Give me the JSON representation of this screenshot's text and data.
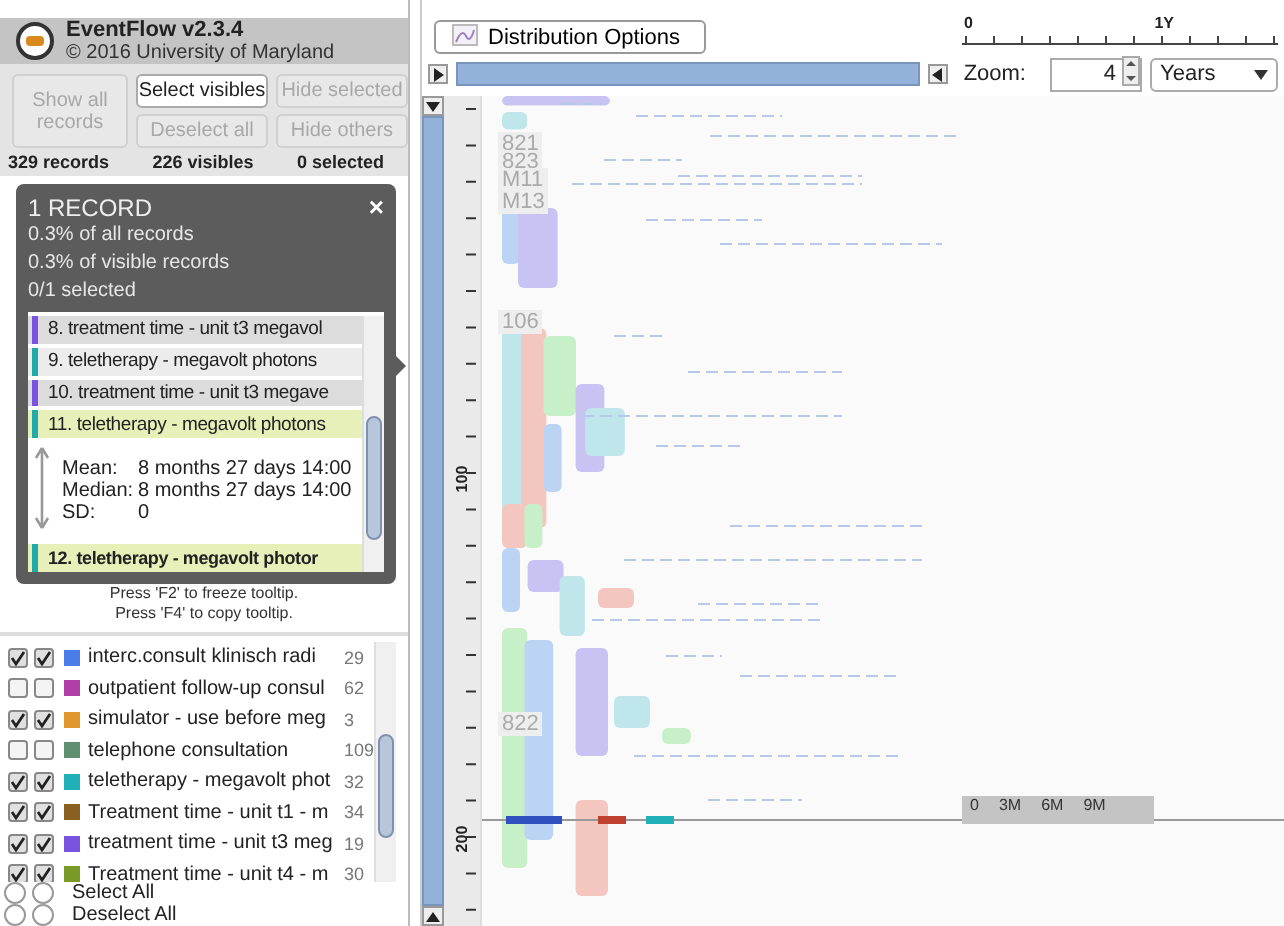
{
  "app": {
    "title": "EventFlow v2.3.4",
    "copyright": "© 2016 University of Maryland"
  },
  "record_buttons": [
    {
      "label": "Show all records",
      "disabled": true
    },
    {
      "label": "Select visibles",
      "disabled": false
    },
    {
      "label": "Hide selected",
      "disabled": true
    },
    {
      "label": "Deselect all",
      "disabled": true
    },
    {
      "label": "Hide others",
      "disabled": true
    }
  ],
  "counts": [
    "329 records",
    "226 visibles",
    "0 selected"
  ],
  "tooltip": {
    "title": "1 RECORD",
    "close": "×",
    "lines": [
      "0.3% of all records",
      "0.3% of visible records",
      "0/1 selected"
    ],
    "items": [
      {
        "kind": "event",
        "label": "8. treatment time - unit t3 megavol",
        "color": "#7b52e0",
        "highlighted": false,
        "bold": false
      },
      {
        "kind": "event",
        "label": "9. teletherapy - megavolt photons",
        "color": "#22aaaa",
        "highlighted": false,
        "bold": false
      },
      {
        "kind": "event",
        "label": "10. treatment time - unit t3 megave",
        "color": "#7b52e0",
        "highlighted": false,
        "bold": false
      },
      {
        "kind": "event",
        "label": "11. teletherapy - megavolt photons",
        "color": "#22aaaa",
        "highlighted": true,
        "bold": false
      },
      {
        "kind": "interval",
        "stats": [
          {
            "label": "Mean:",
            "value": "8 months 27 days 14:00"
          },
          {
            "label": "Median:",
            "value": "8 months 27 days 14:00"
          },
          {
            "label": "SD:",
            "value": "0"
          }
        ]
      },
      {
        "kind": "event",
        "label": "12. teletherapy - megavolt photor",
        "color": "#22aaaa",
        "highlighted": true,
        "bold": true
      }
    ]
  },
  "hints": [
    "Press 'F2' to freeze tooltip.",
    "Press 'F4' to copy tooltip."
  ],
  "legend": [
    {
      "first_checked": true,
      "second_checked": true,
      "color": "#4a7de8",
      "label": "interc.consult klinisch  radi",
      "count": "29"
    },
    {
      "first_checked": false,
      "second_checked": false,
      "color": "#b040a8",
      "label": "outpatient follow-up consul",
      "count": "62"
    },
    {
      "first_checked": true,
      "second_checked": true,
      "color": "#e0962a",
      "label": "simulator - use before meg",
      "count": "3"
    },
    {
      "first_checked": false,
      "second_checked": false,
      "color": "#5f8f70",
      "label": "telephone consultation",
      "count": "109"
    },
    {
      "first_checked": true,
      "second_checked": true,
      "color": "#20b0b8",
      "label": "teletherapy - megavolt phot",
      "count": "32"
    },
    {
      "first_checked": true,
      "second_checked": true,
      "color": "#8a6020",
      "label": "Treatment time - unit t1 - m",
      "count": "34"
    },
    {
      "first_checked": true,
      "second_checked": true,
      "color": "#7b52e0",
      "label": "treatment time - unit t3 meg",
      "count": "19"
    },
    {
      "first_checked": true,
      "second_checked": true,
      "color": "#7a9a28",
      "label": "Treatment time - unit t4 - m",
      "count": "30"
    }
  ],
  "bulk_actions": [
    {
      "label": "Select All",
      "checked": false
    },
    {
      "label": "Deselect All",
      "checked": false
    }
  ],
  "toolbar": {
    "distribution_button": "Distribution Options",
    "time_axis": [
      "0",
      "1Y"
    ],
    "zoom_label": "Zoom:",
    "zoom_value": "4",
    "unit": "Years"
  },
  "ruler": [
    "100",
    "200"
  ],
  "group_labels": [
    "821",
    "823",
    "M11",
    "M13",
    "106",
    "822"
  ],
  "overlay_axis": [
    "0",
    "3M",
    "6M",
    "9M"
  ]
}
